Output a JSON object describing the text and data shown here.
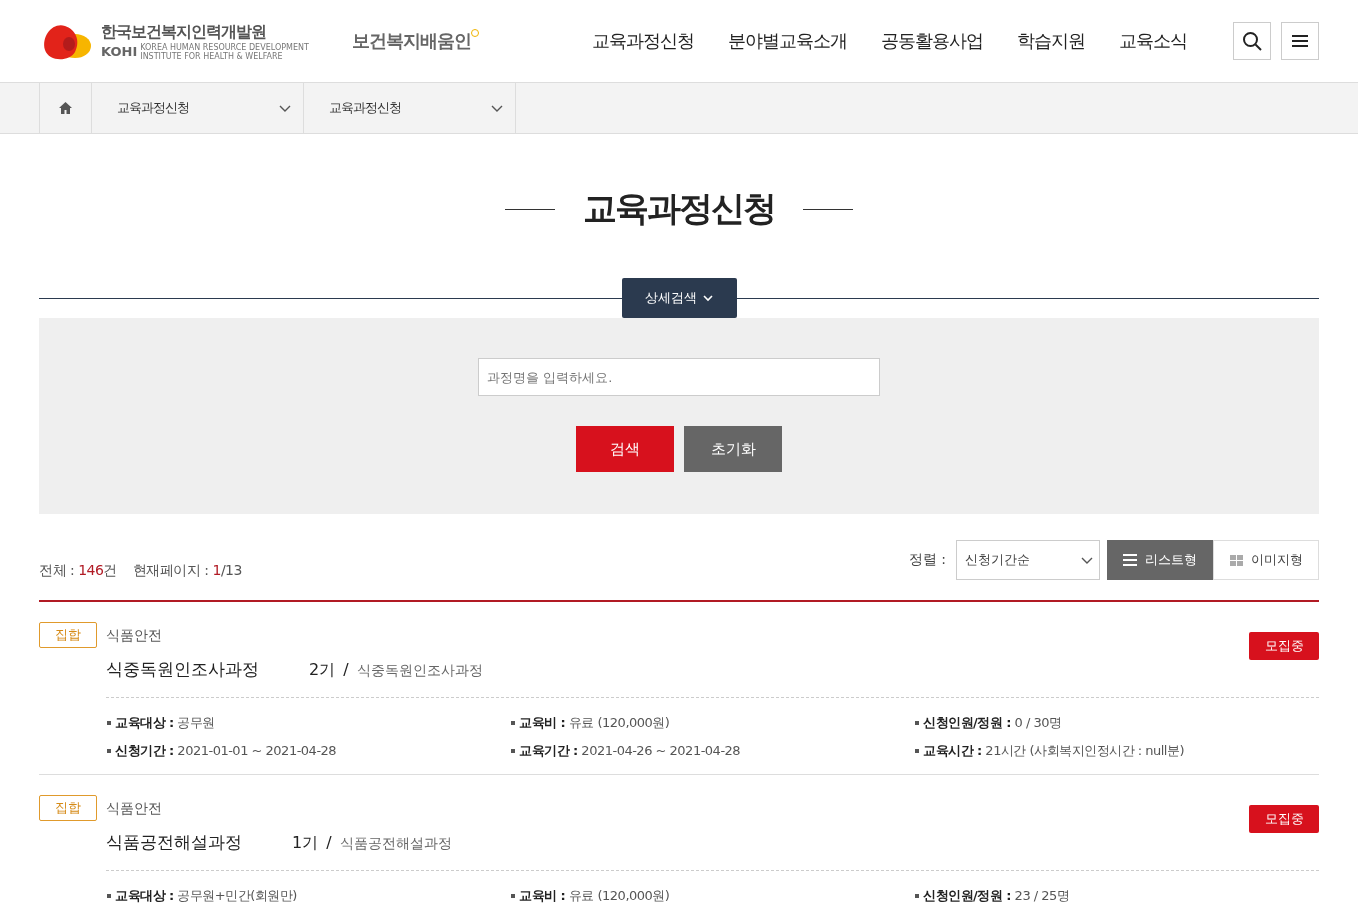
{
  "header": {
    "logo": {
      "org_name": "한국보건복지인력개발원",
      "org_abbr": "KOHI",
      "org_english": "KOREA HUMAN RESOURCE DEVELOPMENT INSTITUTE FOR HEALTH & WELFARE",
      "service_name": "보건복지배움인"
    },
    "nav": [
      "교육과정신청",
      "분야별교육소개",
      "공동활용사업",
      "학습지원",
      "교육소식"
    ]
  },
  "breadcrumb": [
    "교육과정신청",
    "교육과정신청"
  ],
  "page_title": "교육과정신청",
  "search": {
    "toggle": "상세검색",
    "expanded": true,
    "placeholder": "과정명을 입력하세요.",
    "buttons": [
      {
        "label": "검색",
        "kind": "primary"
      },
      {
        "label": "초기화",
        "kind": "secondary"
      }
    ]
  },
  "summary": {
    "total_label": "전체 :",
    "total": "146",
    "total_unit": "건",
    "page_label": "현재페이지 :",
    "current_page": "1",
    "page_count": "/13"
  },
  "sort": {
    "label": "정렬 :",
    "value": "신청기간순"
  },
  "views": [
    {
      "label": "리스트형",
      "kind": "list",
      "selected": true
    },
    {
      "label": "이미지형",
      "kind": "grid",
      "selected": false
    }
  ],
  "courses": [
    {
      "type": "집합",
      "category": "식품안전",
      "title": "식중독원인조사과정",
      "round": "2기",
      "separator": "/",
      "subtitle": "식중독원인조사과정",
      "status": "모집중",
      "details": [
        {
          "label": "교육대상 :",
          "value": "공무원"
        },
        {
          "label": "교육비 :",
          "value": "유료 (120,000원)"
        },
        {
          "label": "신청인원/정원 :",
          "value": "0 / 30명"
        },
        {
          "label": "신청기간 :",
          "value": "2021-01-01 ~ 2021-04-28"
        },
        {
          "label": "교육기간 :",
          "value": "2021-04-26 ~ 2021-04-28"
        },
        {
          "label": "교육시간 :",
          "value": "21시간 (사회복지인정시간 : null분)"
        }
      ]
    },
    {
      "type": "집합",
      "category": "식품안전",
      "title": "식품공전해설과정",
      "round": "1기",
      "separator": "/",
      "subtitle": "식품공전해설과정",
      "status": "모집중",
      "details": [
        {
          "label": "교육대상 :",
          "value": "공무원+민간(회원만)"
        },
        {
          "label": "교육비 :",
          "value": "유료 (120,000원)"
        },
        {
          "label": "신청인원/정원 :",
          "value": "23 / 25명"
        }
      ]
    }
  ]
}
